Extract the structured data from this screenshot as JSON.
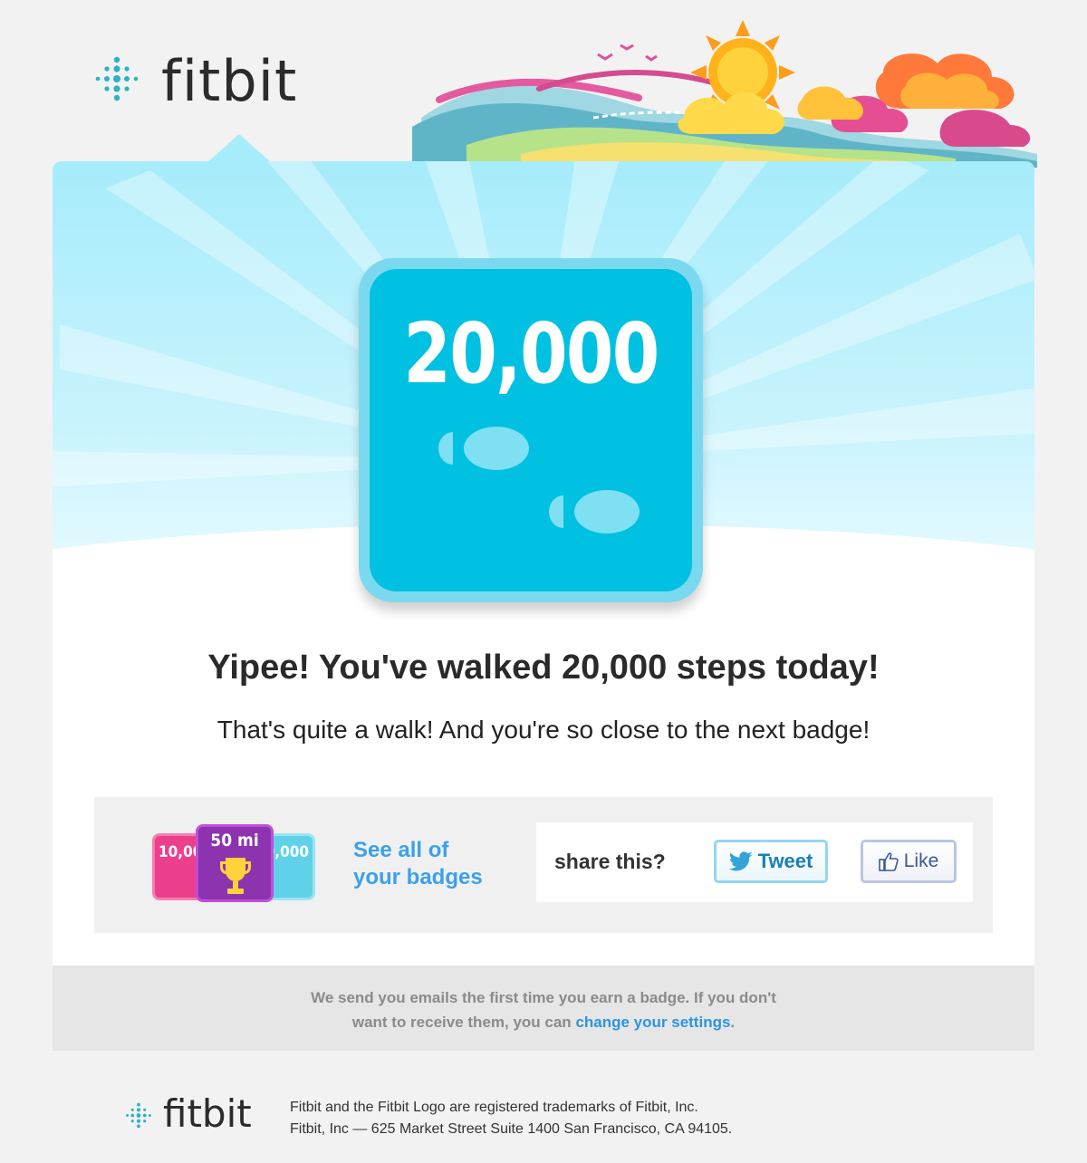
{
  "brand": {
    "name": "fitbit"
  },
  "badge": {
    "number": "20,000"
  },
  "message": {
    "headline": "Yipee! You've walked 20,000 steps today!",
    "subline": "That's quite a walk! And you're so close to the next badge!"
  },
  "mini_badges": {
    "left": "10,000",
    "center": "50 mi",
    "right": "10,000"
  },
  "badges_link": {
    "line1": "See all of",
    "line2": "your badges"
  },
  "share": {
    "label": "share this?",
    "tweet_label": "Tweet",
    "like_label": "Like"
  },
  "notice": {
    "text_line1": "We send you emails the first time you earn a badge. If you don't",
    "text_line2": "want to receive them, you can",
    "link": "change your settings",
    "end": "."
  },
  "footer": {
    "legal_line1": "Fitbit and the Fitbit Logo are registered trademarks of Fitbit, Inc.",
    "legal_line2": "Fitbit, Inc — 625 Market Street Suite 1400 San Francisco, CA 94105."
  },
  "colors": {
    "badge_blue": "#00c1e1",
    "link_blue": "#3aa1ec",
    "sky": "#a6ecfb",
    "pink_badge": "#ec3f8b",
    "purple_badge": "#8d33b0"
  },
  "icons": [
    "fitbit-logo-icon",
    "footprints-icon",
    "trophy-icon",
    "twitter-bird-icon",
    "thumbs-up-icon"
  ]
}
